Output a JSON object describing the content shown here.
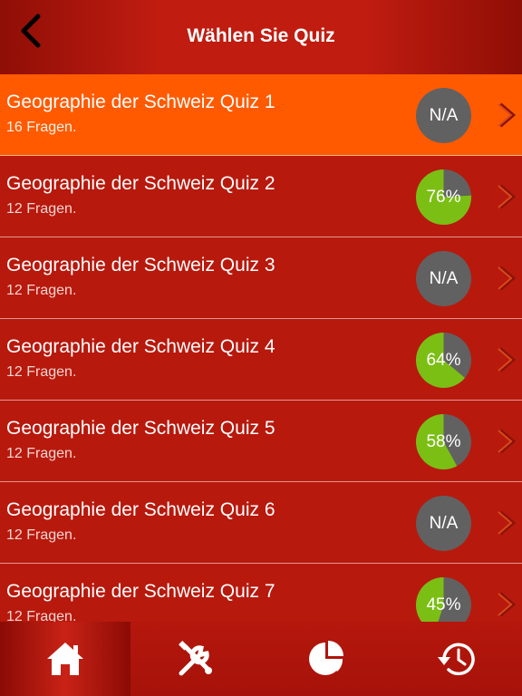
{
  "header": {
    "title": "Wählen Sie Quiz",
    "back_icon": "chevron-left-icon"
  },
  "colors": {
    "header_bg": "#c01c10",
    "row_bg": "#b8190d",
    "selected_row_bg": "#ff5a00",
    "score_grey": "#616161",
    "score_green": "#7bbf14"
  },
  "quizzes": [
    {
      "title": "Geographie der Schweiz Quiz 1",
      "subtitle": "16 Fragen.",
      "score_label": "N/A",
      "score_fraction": null,
      "selected": true
    },
    {
      "title": "Geographie der Schweiz Quiz 2",
      "subtitle": "12 Fragen.",
      "score_label": "76%",
      "score_fraction": 0.76,
      "selected": false
    },
    {
      "title": "Geographie der Schweiz Quiz 3",
      "subtitle": "12 Fragen.",
      "score_label": "N/A",
      "score_fraction": null,
      "selected": false
    },
    {
      "title": "Geographie der Schweiz Quiz 4",
      "subtitle": "12 Fragen.",
      "score_label": "64%",
      "score_fraction": 0.64,
      "selected": false
    },
    {
      "title": "Geographie der Schweiz Quiz 5",
      "subtitle": "12 Fragen.",
      "score_label": "58%",
      "score_fraction": 0.58,
      "selected": false
    },
    {
      "title": "Geographie der Schweiz Quiz 6",
      "subtitle": "12 Fragen.",
      "score_label": "N/A",
      "score_fraction": null,
      "selected": false
    },
    {
      "title": "Geographie der Schweiz Quiz 7",
      "subtitle": "12 Fragen.",
      "score_label": "45%",
      "score_fraction": 0.45,
      "selected": false
    }
  ],
  "tabbar": {
    "tabs": [
      {
        "icon": "home-icon",
        "active": true
      },
      {
        "icon": "tools-icon",
        "active": false
      },
      {
        "icon": "pie-chart-icon",
        "active": false
      },
      {
        "icon": "history-icon",
        "active": false
      }
    ]
  }
}
